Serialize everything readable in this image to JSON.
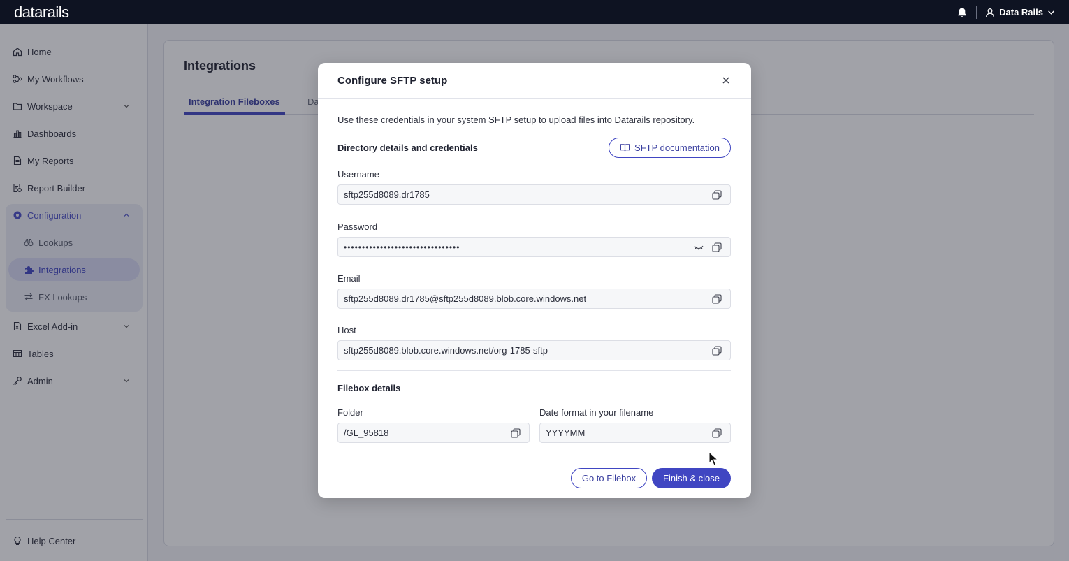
{
  "app": {
    "logo": "datarails",
    "user_name": "Data Rails"
  },
  "sidebar": {
    "items": [
      {
        "label": "Home",
        "icon": "home-icon"
      },
      {
        "label": "My Workflows",
        "icon": "workflow-icon"
      },
      {
        "label": "Workspace",
        "icon": "folder-icon"
      },
      {
        "label": "Dashboards",
        "icon": "bar-chart-icon"
      },
      {
        "label": "My Reports",
        "icon": "report-icon"
      },
      {
        "label": "Report Builder",
        "icon": "report-builder-icon"
      },
      {
        "label": "Configuration",
        "icon": "gear-icon"
      },
      {
        "label": "Lookups",
        "icon": "binoculars-icon"
      },
      {
        "label": "Integrations",
        "icon": "puzzle-icon"
      },
      {
        "label": "FX Lookups",
        "icon": "swap-icon"
      },
      {
        "label": "Excel Add-in",
        "icon": "excel-icon"
      },
      {
        "label": "Tables",
        "icon": "table-icon"
      },
      {
        "label": "Admin",
        "icon": "key-icon"
      }
    ],
    "help": "Help Center"
  },
  "main": {
    "title": "Integrations",
    "tabs": [
      {
        "label": "Integration Fileboxes"
      },
      {
        "label": "Da"
      }
    ]
  },
  "modal": {
    "title": "Configure SFTP setup",
    "intro": "Use these credentials in your system SFTP setup to upload files into Datarails repository.",
    "section1": "Directory details and credentials",
    "doc_button": "SFTP documentation",
    "fields": {
      "username_label": "Username",
      "username_value": "sftp255d8089.dr1785",
      "password_label": "Password",
      "password_value": "••••••••••••••••••••••••••••••••",
      "email_label": "Email",
      "email_value": "sftp255d8089.dr1785@sftp255d8089.blob.core.windows.net",
      "host_label": "Host",
      "host_value": "sftp255d8089.blob.core.windows.net/org-1785-sftp"
    },
    "section2": "Filebox details",
    "folder_label": "Folder",
    "folder_value": "/GL_95818",
    "date_label": "Date format in your filename",
    "date_value": "YYYYMM",
    "go_button": "Go to Filebox",
    "finish_button": "Finish & close"
  },
  "colors": {
    "accent": "#4046c2",
    "topbar": "#0e1322"
  }
}
